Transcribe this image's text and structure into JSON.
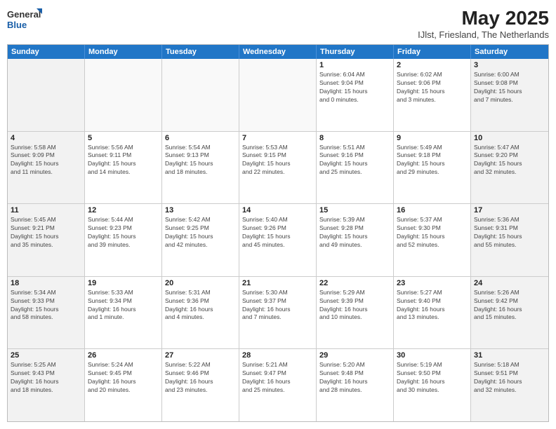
{
  "logo": {
    "general": "General",
    "blue": "Blue"
  },
  "title": "May 2025",
  "subtitle": "IJlst, Friesland, The Netherlands",
  "days": [
    "Sunday",
    "Monday",
    "Tuesday",
    "Wednesday",
    "Thursday",
    "Friday",
    "Saturday"
  ],
  "weeks": [
    [
      {
        "day": "",
        "info": ""
      },
      {
        "day": "",
        "info": ""
      },
      {
        "day": "",
        "info": ""
      },
      {
        "day": "",
        "info": ""
      },
      {
        "day": "1",
        "info": "Sunrise: 6:04 AM\nSunset: 9:04 PM\nDaylight: 15 hours\nand 0 minutes."
      },
      {
        "day": "2",
        "info": "Sunrise: 6:02 AM\nSunset: 9:06 PM\nDaylight: 15 hours\nand 3 minutes."
      },
      {
        "day": "3",
        "info": "Sunrise: 6:00 AM\nSunset: 9:08 PM\nDaylight: 15 hours\nand 7 minutes."
      }
    ],
    [
      {
        "day": "4",
        "info": "Sunrise: 5:58 AM\nSunset: 9:09 PM\nDaylight: 15 hours\nand 11 minutes."
      },
      {
        "day": "5",
        "info": "Sunrise: 5:56 AM\nSunset: 9:11 PM\nDaylight: 15 hours\nand 14 minutes."
      },
      {
        "day": "6",
        "info": "Sunrise: 5:54 AM\nSunset: 9:13 PM\nDaylight: 15 hours\nand 18 minutes."
      },
      {
        "day": "7",
        "info": "Sunrise: 5:53 AM\nSunset: 9:15 PM\nDaylight: 15 hours\nand 22 minutes."
      },
      {
        "day": "8",
        "info": "Sunrise: 5:51 AM\nSunset: 9:16 PM\nDaylight: 15 hours\nand 25 minutes."
      },
      {
        "day": "9",
        "info": "Sunrise: 5:49 AM\nSunset: 9:18 PM\nDaylight: 15 hours\nand 29 minutes."
      },
      {
        "day": "10",
        "info": "Sunrise: 5:47 AM\nSunset: 9:20 PM\nDaylight: 15 hours\nand 32 minutes."
      }
    ],
    [
      {
        "day": "11",
        "info": "Sunrise: 5:45 AM\nSunset: 9:21 PM\nDaylight: 15 hours\nand 35 minutes."
      },
      {
        "day": "12",
        "info": "Sunrise: 5:44 AM\nSunset: 9:23 PM\nDaylight: 15 hours\nand 39 minutes."
      },
      {
        "day": "13",
        "info": "Sunrise: 5:42 AM\nSunset: 9:25 PM\nDaylight: 15 hours\nand 42 minutes."
      },
      {
        "day": "14",
        "info": "Sunrise: 5:40 AM\nSunset: 9:26 PM\nDaylight: 15 hours\nand 45 minutes."
      },
      {
        "day": "15",
        "info": "Sunrise: 5:39 AM\nSunset: 9:28 PM\nDaylight: 15 hours\nand 49 minutes."
      },
      {
        "day": "16",
        "info": "Sunrise: 5:37 AM\nSunset: 9:30 PM\nDaylight: 15 hours\nand 52 minutes."
      },
      {
        "day": "17",
        "info": "Sunrise: 5:36 AM\nSunset: 9:31 PM\nDaylight: 15 hours\nand 55 minutes."
      }
    ],
    [
      {
        "day": "18",
        "info": "Sunrise: 5:34 AM\nSunset: 9:33 PM\nDaylight: 15 hours\nand 58 minutes."
      },
      {
        "day": "19",
        "info": "Sunrise: 5:33 AM\nSunset: 9:34 PM\nDaylight: 16 hours\nand 1 minute."
      },
      {
        "day": "20",
        "info": "Sunrise: 5:31 AM\nSunset: 9:36 PM\nDaylight: 16 hours\nand 4 minutes."
      },
      {
        "day": "21",
        "info": "Sunrise: 5:30 AM\nSunset: 9:37 PM\nDaylight: 16 hours\nand 7 minutes."
      },
      {
        "day": "22",
        "info": "Sunrise: 5:29 AM\nSunset: 9:39 PM\nDaylight: 16 hours\nand 10 minutes."
      },
      {
        "day": "23",
        "info": "Sunrise: 5:27 AM\nSunset: 9:40 PM\nDaylight: 16 hours\nand 13 minutes."
      },
      {
        "day": "24",
        "info": "Sunrise: 5:26 AM\nSunset: 9:42 PM\nDaylight: 16 hours\nand 15 minutes."
      }
    ],
    [
      {
        "day": "25",
        "info": "Sunrise: 5:25 AM\nSunset: 9:43 PM\nDaylight: 16 hours\nand 18 minutes."
      },
      {
        "day": "26",
        "info": "Sunrise: 5:24 AM\nSunset: 9:45 PM\nDaylight: 16 hours\nand 20 minutes."
      },
      {
        "day": "27",
        "info": "Sunrise: 5:22 AM\nSunset: 9:46 PM\nDaylight: 16 hours\nand 23 minutes."
      },
      {
        "day": "28",
        "info": "Sunrise: 5:21 AM\nSunset: 9:47 PM\nDaylight: 16 hours\nand 25 minutes."
      },
      {
        "day": "29",
        "info": "Sunrise: 5:20 AM\nSunset: 9:48 PM\nDaylight: 16 hours\nand 28 minutes."
      },
      {
        "day": "30",
        "info": "Sunrise: 5:19 AM\nSunset: 9:50 PM\nDaylight: 16 hours\nand 30 minutes."
      },
      {
        "day": "31",
        "info": "Sunrise: 5:18 AM\nSunset: 9:51 PM\nDaylight: 16 hours\nand 32 minutes."
      }
    ]
  ]
}
